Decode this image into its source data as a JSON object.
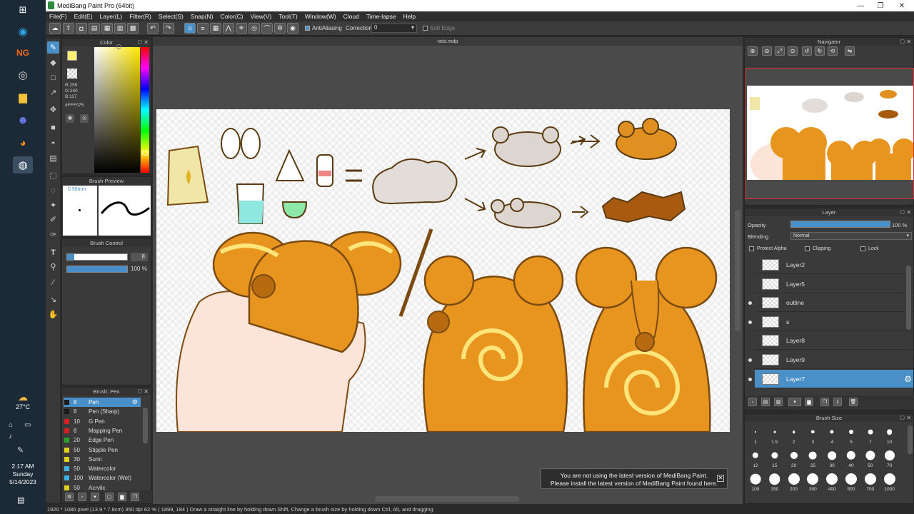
{
  "colors": {
    "accent": "#4a90c8",
    "foreground": "#FFF075",
    "canvas_bg": "#4a4a4a",
    "panel_bg": "#3a3a3a"
  },
  "taskbar": {
    "icons": [
      "windows-icon",
      "edge-icon",
      "newgrounds-icon",
      "obs-icon",
      "file-explorer-icon",
      "discord-icon",
      "firefox-icon",
      "medibang-icon"
    ],
    "weather": {
      "temp": "27°C"
    },
    "clock": {
      "time": "2:17 AM",
      "day": "Sunday",
      "date": "5/14/2023"
    }
  },
  "titlebar": {
    "title": "MediBang Paint Pro (64bit)"
  },
  "menu": [
    "File(F)",
    "Edit(E)",
    "Layer(L)",
    "Filter(R)",
    "Select(S)",
    "Snap(N)",
    "Color(C)",
    "View(V)",
    "Tool(T)",
    "Window(W)",
    "Cloud",
    "Time-lapse",
    "Help"
  ],
  "toolbar": {
    "antialiasing_label": "AntiAliasing",
    "correction_label": "Correction",
    "correction_value": "0",
    "soft_edge_label": "Soft Edge"
  },
  "color_panel": {
    "title": "Color",
    "r": "R:255",
    "g": "G:240",
    "b": "B:117",
    "hex": "#FFF075"
  },
  "brush_preview": {
    "title": "Brush Preview",
    "size": "0.58mm"
  },
  "brush_control": {
    "title": "Brush Control",
    "size_value": "8",
    "opacity_value": "100 %"
  },
  "brush_list": {
    "title": "Brush: Pen",
    "items": [
      {
        "size": "8",
        "name": "Pen",
        "color": "#1a1a1a"
      },
      {
        "size": "8",
        "name": "Pen (Sharp)",
        "color": "#1a1a1a"
      },
      {
        "size": "10",
        "name": "G Pen",
        "color": "#d42020"
      },
      {
        "size": "8",
        "name": "Mapping Pen",
        "color": "#d42020"
      },
      {
        "size": "20",
        "name": "Edge Pen",
        "color": "#2aa02a"
      },
      {
        "size": "50",
        "name": "Stipple Pen",
        "color": "#e0d020"
      },
      {
        "size": "30",
        "name": "Sumi",
        "color": "#e0d020"
      },
      {
        "size": "50",
        "name": "Watercolor",
        "color": "#40b0e0"
      },
      {
        "size": "100",
        "name": "Watercolor (Wet)",
        "color": "#40b0e0"
      },
      {
        "size": "50",
        "name": "Acrylic",
        "color": "#e0d020"
      }
    ]
  },
  "document": {
    "tab": "rats.mdp"
  },
  "notice": {
    "line1": "You are not using the latest version of MediBang Paint.",
    "line2": "Please install the latest version of MediBang Paint found here."
  },
  "navigator": {
    "title": "Navigator"
  },
  "layer_panel": {
    "title": "Layer",
    "opacity_label": "Opacity",
    "opacity_value": "100 %",
    "opacity_fraction": 1.0,
    "blending_label": "Blending",
    "blending_value": "Normal",
    "protect_alpha": "Protect Alpha",
    "clipping": "Clipping",
    "lock": "Lock",
    "layers": [
      {
        "name": "Layer2",
        "visible": false
      },
      {
        "name": "Layer5",
        "visible": false
      },
      {
        "name": "outline",
        "visible": true
      },
      {
        "name": "s",
        "visible": true
      },
      {
        "name": "Layer8",
        "visible": false
      },
      {
        "name": "Layer9",
        "visible": true
      },
      {
        "name": "Layer7",
        "visible": true
      }
    ]
  },
  "brush_size": {
    "title": "Brush Size",
    "sizes": [
      "1",
      "1.5",
      "2",
      "3",
      "4",
      "5",
      "7",
      "10",
      "12",
      "15",
      "20",
      "25",
      "30",
      "40",
      "50",
      "70",
      "100",
      "150",
      "200",
      "300",
      "400",
      "500",
      "700",
      "1000"
    ]
  },
  "status": {
    "text": "1920 * 1080 pixel   (13.9 * 7.8cm)   350 dpi   62 %   ( 1899, 184 )   Draw a straight line by holding down Shift, Change a brush size by holding down Ctrl, Alt, and dragging"
  }
}
